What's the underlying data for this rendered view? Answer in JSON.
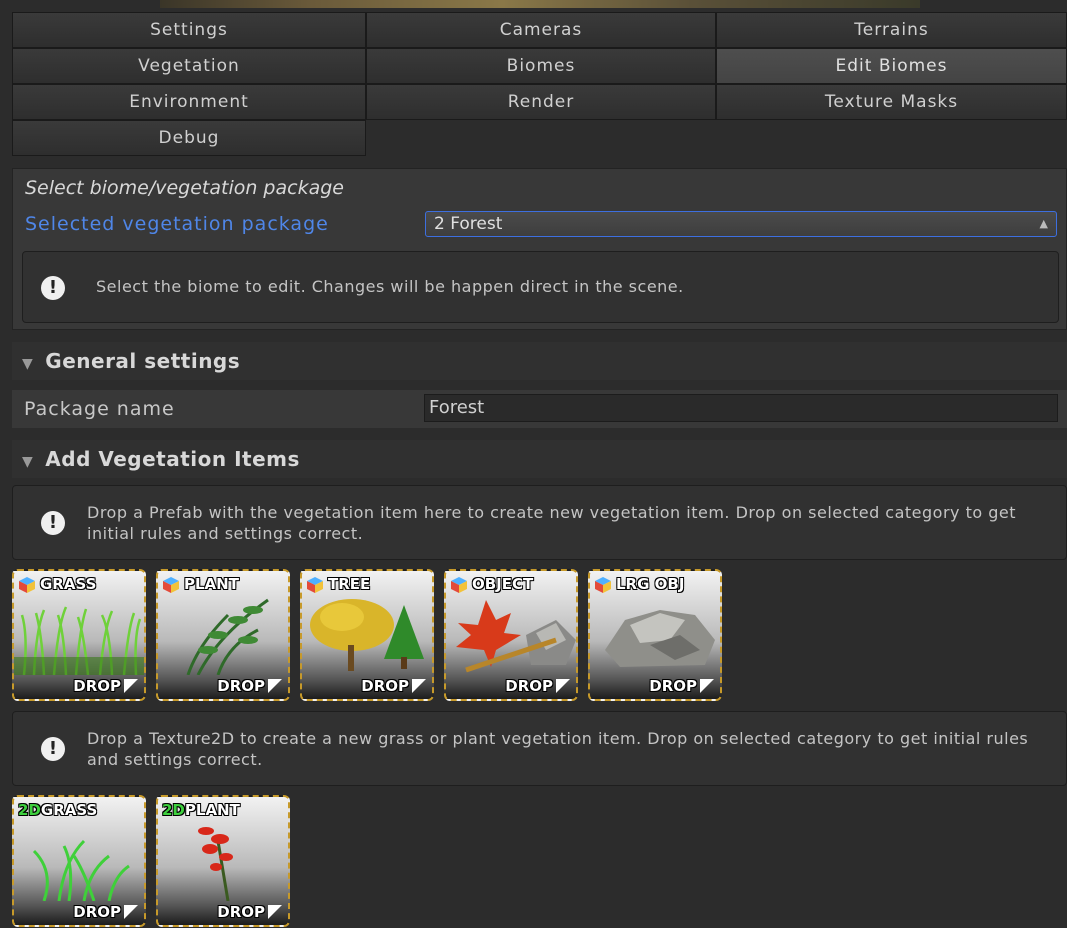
{
  "tabs": [
    {
      "label": "Settings"
    },
    {
      "label": "Cameras"
    },
    {
      "label": "Terrains"
    },
    {
      "label": "Vegetation"
    },
    {
      "label": "Biomes"
    },
    {
      "label": "Edit Biomes"
    },
    {
      "label": "Environment"
    },
    {
      "label": "Render"
    },
    {
      "label": "Texture Masks"
    },
    {
      "label": "Debug"
    }
  ],
  "active_tab": "Edit Biomes",
  "select_panel": {
    "title": "Select biome/vegetation package",
    "label": "Selected vegetation package",
    "selected_value": "2 Forest",
    "help": "Select the biome to edit. Changes will be happen direct in the scene."
  },
  "general_settings": {
    "header": "General settings",
    "package_name_label": "Package name",
    "package_name_value": "Forest"
  },
  "add_items": {
    "header": "Add Vegetation Items",
    "prefab_help": "Drop a Prefab with the vegetation item here to create new vegetation item. Drop on selected category to get initial rules and settings correct.",
    "prefab_tiles": [
      {
        "label": "GRASS",
        "drop": "DROP"
      },
      {
        "label": "PLANT",
        "drop": "DROP"
      },
      {
        "label": "TREE",
        "drop": "DROP"
      },
      {
        "label": "OBJECT",
        "drop": "DROP"
      },
      {
        "label": "LRG OBJ",
        "drop": "DROP"
      }
    ],
    "texture_help": "Drop a Texture2D to create a new grass or plant vegetation item. Drop on selected category to get initial rules and settings correct.",
    "texture_tiles": [
      {
        "tag": "2D",
        "label": "GRASS",
        "drop": "DROP"
      },
      {
        "tag": "2D",
        "label": "PLANT",
        "drop": "DROP"
      }
    ]
  },
  "colors": {
    "accent_blue": "#4f86e8",
    "tile_border": "#c79a2a",
    "tex2d_green": "#3ecf3e"
  }
}
